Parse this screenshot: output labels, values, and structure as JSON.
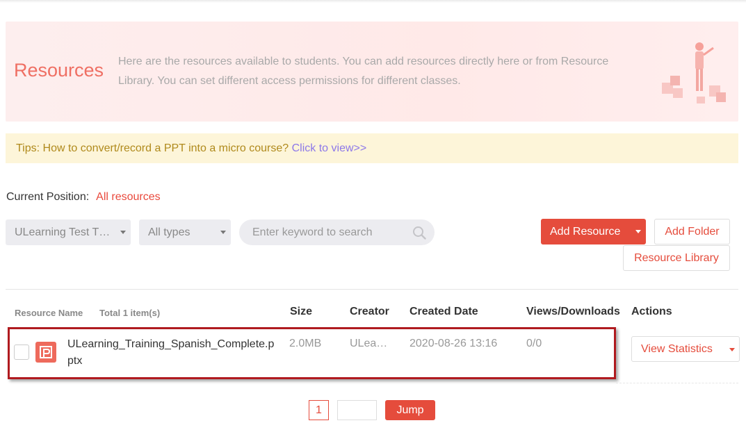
{
  "banner": {
    "title": "Resources",
    "description": "Here are the resources available to students. You can add resources directly here or from Resource Library. You can set different access permissions for different classes."
  },
  "tips": {
    "text": "Tips: How to convert/record a PPT into a micro course? ",
    "link": "Click to view>>"
  },
  "position": {
    "label": "Current Position:",
    "value": "All resources"
  },
  "toolbar": {
    "course_select": "ULearning Test T…",
    "type_select": "All types",
    "search_placeholder": "Enter keyword to search",
    "add_resource": "Add Resource",
    "add_folder": "Add Folder",
    "resource_library": "Resource Library"
  },
  "table": {
    "headers": {
      "name": "Resource Name",
      "total": "Total 1 item(s)",
      "size": "Size",
      "creator": "Creator",
      "created": "Created Date",
      "views": "Views/Downloads",
      "actions": "Actions"
    },
    "rows": [
      {
        "name": "ULearning_Training_Spanish_Complete.pptx",
        "size": "2.0MB",
        "creator": "ULea…",
        "created": "2020-08-26 13:16",
        "views": "0/0",
        "action": "View Statistics"
      }
    ]
  },
  "pagination": {
    "current": "1",
    "jump": "Jump"
  },
  "colors": {
    "accent": "#e54c3c",
    "highlight_border": "#b01a1f",
    "tips_bg": "#fdf5d9"
  }
}
